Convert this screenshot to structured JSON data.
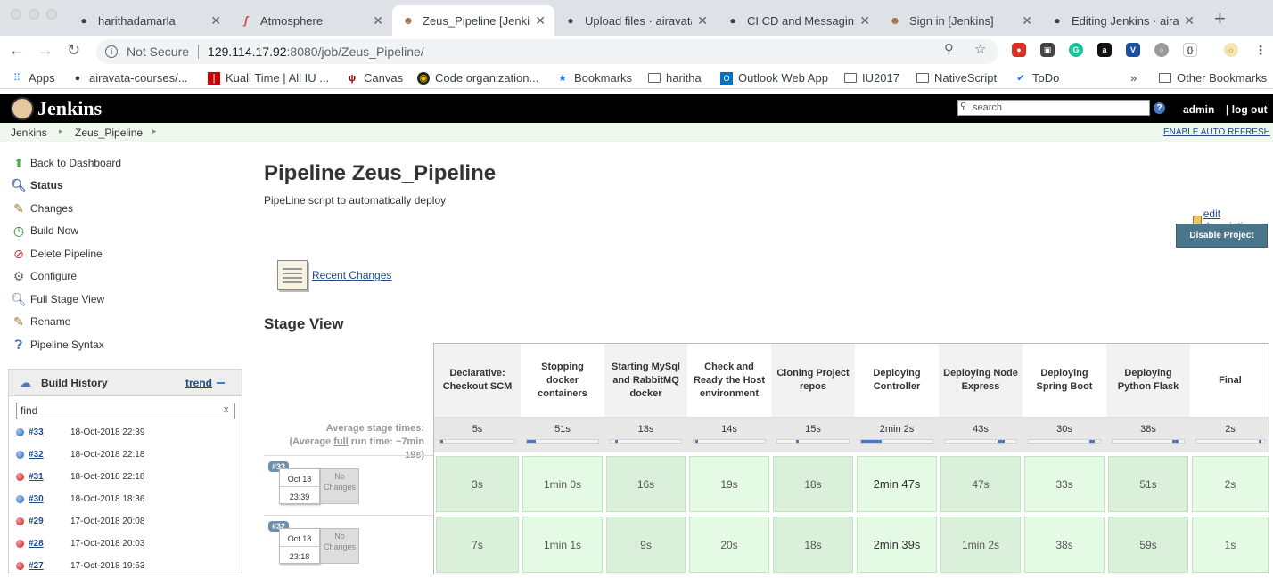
{
  "browser": {
    "tabs": [
      {
        "title": "harithadamarla",
        "icon": "github-icon"
      },
      {
        "title": "Atmosphere",
        "icon": "atmosphere-icon"
      },
      {
        "title": "Zeus_Pipeline [Jenkins]",
        "icon": "jenkins-icon"
      },
      {
        "title": "Upload files · airavata",
        "icon": "github-icon"
      },
      {
        "title": "CI CD and Messaging",
        "icon": "github-icon"
      },
      {
        "title": "Sign in [Jenkins]",
        "icon": "jenkins-icon"
      },
      {
        "title": "Editing Jenkins · airavata",
        "icon": "github-icon"
      }
    ],
    "url": {
      "security_label": "Not Secure",
      "host": "129.114.17.92",
      "path": ":8080/job/Zeus_Pipeline/"
    },
    "bookmarks": [
      {
        "label": "Apps",
        "icon": "apps-grid-icon"
      },
      {
        "label": "airavata-courses/...",
        "icon": "github-icon"
      },
      {
        "label": "Kuali Time | All IU ...",
        "icon": "kuali-icon"
      },
      {
        "label": "Canvas",
        "icon": "iu-icon"
      },
      {
        "label": "Code organization...",
        "icon": "code-icon"
      },
      {
        "label": "Bookmarks",
        "icon": "star-icon"
      },
      {
        "label": "haritha",
        "icon": "folder-icon"
      },
      {
        "label": "Outlook Web App",
        "icon": "outlook-icon"
      },
      {
        "label": "IU2017",
        "icon": "folder-icon"
      },
      {
        "label": "NativeScript",
        "icon": "folder-icon"
      },
      {
        "label": "ToDo",
        "icon": "check-icon"
      }
    ],
    "other_bookmarks": "Other Bookmarks",
    "overflow": "»"
  },
  "jenkins": {
    "brand": "Jenkins",
    "search_placeholder": "search",
    "help": "?",
    "user": "admin",
    "logout": "| log out",
    "breadcrumbs": [
      "Jenkins",
      "Zeus_Pipeline"
    ],
    "auto_refresh": "ENABLE AUTO REFRESH"
  },
  "sidebar": {
    "tasks": [
      {
        "label": "Back to Dashboard",
        "icon": "up-arrow-icon",
        "bold": false
      },
      {
        "label": "Status",
        "icon": "magnifier-icon",
        "bold": true
      },
      {
        "label": "Changes",
        "icon": "notepad-icon",
        "bold": false
      },
      {
        "label": "Build Now",
        "icon": "clock-icon",
        "bold": false
      },
      {
        "label": "Delete Pipeline",
        "icon": "no-entry-icon",
        "bold": false
      },
      {
        "label": "Configure",
        "icon": "gear-icon",
        "bold": false
      },
      {
        "label": "Full Stage View",
        "icon": "magnifier-icon",
        "bold": false
      },
      {
        "label": "Rename",
        "icon": "notepad-icon",
        "bold": false
      },
      {
        "label": "Pipeline Syntax",
        "icon": "help-icon",
        "bold": false
      }
    ],
    "build_history": {
      "title": "Build History",
      "trend": "trend",
      "find_value": "find",
      "clear": "x",
      "builds": [
        {
          "num": "#33",
          "date": "18-Oct-2018 22:39",
          "status": "blue"
        },
        {
          "num": "#32",
          "date": "18-Oct-2018 22:18",
          "status": "blue"
        },
        {
          "num": "#31",
          "date": "18-Oct-2018 22:18",
          "status": "red"
        },
        {
          "num": "#30",
          "date": "18-Oct-2018 18:36",
          "status": "blue"
        },
        {
          "num": "#29",
          "date": "17-Oct-2018 20:08",
          "status": "red"
        },
        {
          "num": "#28",
          "date": "17-Oct-2018 20:03",
          "status": "red"
        },
        {
          "num": "#27",
          "date": "17-Oct-2018 19:53",
          "status": "red"
        }
      ]
    }
  },
  "main": {
    "title": "Pipeline Zeus_Pipeline",
    "description": "PipeLine script to automatically deploy",
    "edit_description": "edit description",
    "disable_button": "Disable Project",
    "recent_changes": "Recent Changes",
    "stage_view_title": "Stage View",
    "avg_label_1": "Average stage times:",
    "avg_label_2": "(Average",
    "avg_label_full": "full",
    "avg_label_3": "run time: ~7min",
    "avg_label_4": "19s)",
    "stages": [
      {
        "name": "Declarative: Checkout SCM",
        "avg": "5s",
        "avg_fraction": 0.02
      },
      {
        "name": "Stopping docker containers",
        "avg": "51s",
        "avg_fraction": 0.12
      },
      {
        "name": "Starting MySql and RabbitMQ docker",
        "avg": "13s",
        "avg_fraction": 0.03
      },
      {
        "name": "Check and Ready the Host environment",
        "avg": "14s",
        "avg_fraction": 0.03
      },
      {
        "name": "Cloning Project repos",
        "avg": "15s",
        "avg_fraction": 0.03
      },
      {
        "name": "Deploying Controller",
        "avg": "2min 2s",
        "avg_fraction": 0.28
      },
      {
        "name": "Deploying Node Express",
        "avg": "43s",
        "avg_fraction": 0.1
      },
      {
        "name": "Deploying Spring Boot",
        "avg": "30s",
        "avg_fraction": 0.07
      },
      {
        "name": "Deploying Python Flask",
        "avg": "38s",
        "avg_fraction": 0.09
      },
      {
        "name": "Final",
        "avg": "2s",
        "avg_fraction": 0.01
      }
    ],
    "runs": [
      {
        "badge": "#33",
        "date": "Oct 18",
        "time": "23:39",
        "changes": "No Changes",
        "durations": [
          "3s",
          "1min 0s",
          "16s",
          "19s",
          "18s",
          "2min 47s",
          "47s",
          "33s",
          "51s",
          "2s"
        ]
      },
      {
        "badge": "#32",
        "date": "Oct 18",
        "time": "23:18",
        "changes": "No Changes",
        "durations": [
          "7s",
          "1min 1s",
          "9s",
          "20s",
          "18s",
          "2min 39s",
          "1min 2s",
          "38s",
          "59s",
          "1s"
        ]
      }
    ]
  }
}
